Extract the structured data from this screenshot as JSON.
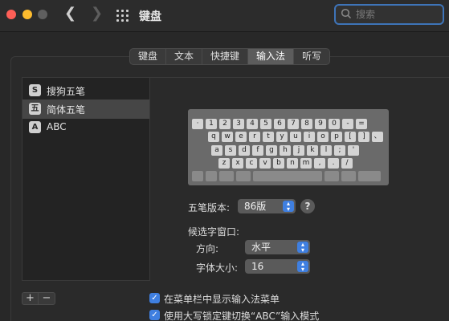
{
  "window": {
    "title": "键盘",
    "search_placeholder": "搜索"
  },
  "tabs": [
    {
      "label": "键盘"
    },
    {
      "label": "文本"
    },
    {
      "label": "快捷键"
    },
    {
      "label": "输入法"
    },
    {
      "label": "听写"
    }
  ],
  "sources": [
    {
      "label": "搜狗五笔",
      "icon": "S"
    },
    {
      "label": "简体五笔",
      "icon": "五"
    },
    {
      "label": "ABC",
      "icon": "A"
    }
  ],
  "keyboard": {
    "row1": [
      "·",
      "1",
      "2",
      "3",
      "4",
      "5",
      "6",
      "7",
      "8",
      "9",
      "0",
      "-",
      "="
    ],
    "row2": [
      "q",
      "w",
      "e",
      "r",
      "t",
      "y",
      "u",
      "i",
      "o",
      "p",
      "[",
      "]",
      "、"
    ],
    "row3": [
      "a",
      "s",
      "d",
      "f",
      "g",
      "h",
      "j",
      "k",
      "l",
      ";",
      "'"
    ],
    "row4": [
      "z",
      "x",
      "c",
      "v",
      "b",
      "n",
      "m",
      ",",
      ".",
      "/"
    ]
  },
  "form": {
    "version_label": "五笔版本:",
    "version_value": "86版",
    "help": "?",
    "candidate_label": "候选字窗口:",
    "direction_label": "方向:",
    "direction_value": "水平",
    "fontsize_label": "字体大小:",
    "fontsize_value": "16"
  },
  "controls": {
    "add": "+",
    "remove": "−"
  },
  "checkboxes": [
    {
      "label": "在菜单栏中显示输入法菜单",
      "checked": true
    },
    {
      "label": "使用大写锁定键切换“ABC”输入模式",
      "checked": true
    }
  ]
}
